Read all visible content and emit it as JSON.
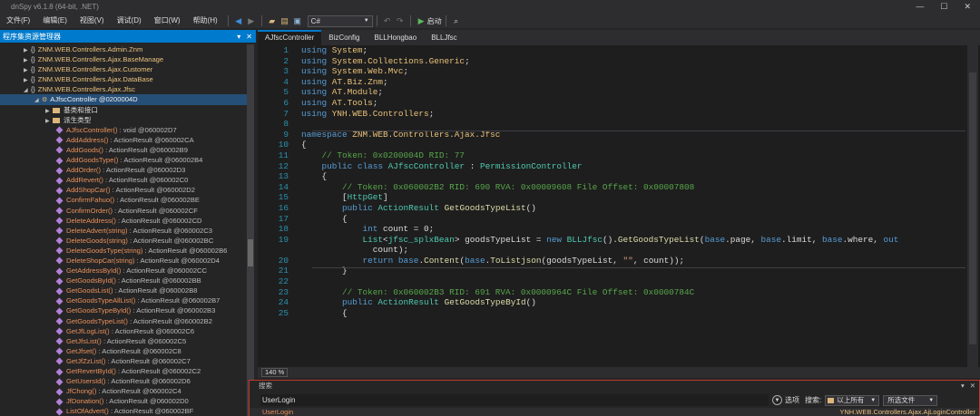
{
  "window": {
    "title": "dnSpy v6.1.8 (64-bit, .NET)",
    "minimize": "—",
    "restore": "☐",
    "close": "✕"
  },
  "menu": [
    {
      "label": "文件(F)"
    },
    {
      "label": "编辑(E)"
    },
    {
      "label": "视图(V)"
    },
    {
      "label": "调试(D)"
    },
    {
      "label": "窗口(W)"
    },
    {
      "label": "帮助(H)"
    }
  ],
  "toolbar": {
    "language": "C#",
    "run_label": "启动"
  },
  "explorer": {
    "title": "程序集资源管理器",
    "namespaces": [
      "ZNM.WEB.Controllers.Admin.Znm",
      "ZNM.WEB.Controllers.Ajax.BaseManage",
      "ZNM.WEB.Controllers.Ajax.Customer",
      "ZNM.WEB.Controllers.Ajax.DataBase",
      "ZNM.WEB.Controllers.Ajax.Jfsc"
    ],
    "selected_class": "AJfscController @0200004D",
    "folders": [
      "基类和接口",
      "派生类型"
    ],
    "methods": [
      {
        "name": "AJfscController()",
        "rest": " : void @060002D7"
      },
      {
        "name": "AddAddress()",
        "rest": " : ActionResult @060002CA"
      },
      {
        "name": "AddGoods()",
        "rest": " : ActionResult @060002B9"
      },
      {
        "name": "AddGoodsType()",
        "rest": " : ActionResult @060002B4"
      },
      {
        "name": "AddOrder()",
        "rest": " : ActionResult @060002D3"
      },
      {
        "name": "AddRevert()",
        "rest": " : ActionResult @060002C0"
      },
      {
        "name": "AddShopCar()",
        "rest": " : ActionResult @060002D2"
      },
      {
        "name": "ConfirmFahuo()",
        "rest": " : ActionResult @060002BE"
      },
      {
        "name": "ConfirmOrder()",
        "rest": " : ActionResult @060002CF"
      },
      {
        "name": "DeleteAddress()",
        "rest": " : ActionResult @060002CD"
      },
      {
        "name": "DeleteAdvert(string)",
        "rest": " : ActionResult @060002C3"
      },
      {
        "name": "DeleteGoods(string)",
        "rest": " : ActionResult @060002BC"
      },
      {
        "name": "DeleteGoodsType(string)",
        "rest": " : ActionResult @060002B6"
      },
      {
        "name": "DeleteShopCar(string)",
        "rest": " : ActionResult @060002D4"
      },
      {
        "name": "GetAddressById()",
        "rest": " : ActionResult @060002CC"
      },
      {
        "name": "GetGoodsById()",
        "rest": " : ActionResult @060002BB"
      },
      {
        "name": "GetGoodsList()",
        "rest": " : ActionResult @060002B8"
      },
      {
        "name": "GetGoodsTypeAllList()",
        "rest": " : ActionResult @060002B7"
      },
      {
        "name": "GetGoodsTypeById()",
        "rest": " : ActionResult @060002B3"
      },
      {
        "name": "GetGoodsTypeList()",
        "rest": " : ActionResult @060002B2"
      },
      {
        "name": "GetJfLogList()",
        "rest": " : ActionResult @060002C6"
      },
      {
        "name": "GetJfsList()",
        "rest": " : ActionResult @060002C5"
      },
      {
        "name": "GetJfset()",
        "rest": " : ActionResult @060002C8"
      },
      {
        "name": "GetJfZzList()",
        "rest": " : ActionResult @060002C7"
      },
      {
        "name": "GetRevertById()",
        "rest": " : ActionResult @060002C2"
      },
      {
        "name": "GetUsersId()",
        "rest": " : ActionResult @060002D6"
      },
      {
        "name": "JfChong()",
        "rest": " : ActionResult @060002C4"
      },
      {
        "name": "JfDonation()",
        "rest": " : ActionResult @060002D0"
      },
      {
        "name": "ListOfAdvert()",
        "rest": " : ActionResult @060002BF"
      }
    ]
  },
  "tabs": [
    {
      "label": "AJfscController"
    },
    {
      "label": "BizConfig"
    },
    {
      "label": "BLLHongbao"
    },
    {
      "label": "BLLJfsc"
    }
  ],
  "code": {
    "lines": [
      {
        "n": "1",
        "parts": [
          [
            "kw",
            "using"
          ],
          [
            "tx",
            " "
          ],
          [
            "ns",
            "System"
          ],
          [
            "tx",
            ";"
          ]
        ]
      },
      {
        "n": "2",
        "parts": [
          [
            "kw",
            "using"
          ],
          [
            "tx",
            " "
          ],
          [
            "ns",
            "System.Collections.Generic"
          ],
          [
            "tx",
            ";"
          ]
        ]
      },
      {
        "n": "3",
        "parts": [
          [
            "kw",
            "using"
          ],
          [
            "tx",
            " "
          ],
          [
            "ns",
            "System.Web.Mvc"
          ],
          [
            "tx",
            ";"
          ]
        ]
      },
      {
        "n": "4",
        "parts": [
          [
            "kw",
            "using"
          ],
          [
            "tx",
            " "
          ],
          [
            "ns",
            "AT.Biz.Znm"
          ],
          [
            "tx",
            ";"
          ]
        ]
      },
      {
        "n": "5",
        "parts": [
          [
            "kw",
            "using"
          ],
          [
            "tx",
            " "
          ],
          [
            "ns",
            "AT.Module"
          ],
          [
            "tx",
            ";"
          ]
        ]
      },
      {
        "n": "6",
        "parts": [
          [
            "kw",
            "using"
          ],
          [
            "tx",
            " "
          ],
          [
            "ns",
            "AT.Tools"
          ],
          [
            "tx",
            ";"
          ]
        ]
      },
      {
        "n": "7",
        "parts": [
          [
            "kw",
            "using"
          ],
          [
            "tx",
            " "
          ],
          [
            "ns",
            "YNH.WEB.Controllers"
          ],
          [
            "tx",
            ";"
          ]
        ]
      },
      {
        "n": "8",
        "parts": []
      },
      {
        "n": "9",
        "parts": [
          [
            "kw",
            "namespace"
          ],
          [
            "tx",
            " "
          ],
          [
            "ns",
            "ZNM.WEB.Controllers.Ajax.Jfsc"
          ]
        ]
      },
      {
        "n": "10",
        "parts": [
          [
            "tx",
            "{"
          ]
        ]
      },
      {
        "n": "11",
        "parts": [
          [
            "tx",
            "    "
          ],
          [
            "cm",
            "// Token: 0x0200004D RID: 77"
          ]
        ]
      },
      {
        "n": "12",
        "parts": [
          [
            "tx",
            "    "
          ],
          [
            "kw",
            "public class"
          ],
          [
            "tx",
            " "
          ],
          [
            "ty",
            "AJfscController"
          ],
          [
            "tx",
            " : "
          ],
          [
            "ty",
            "PermissionController"
          ]
        ]
      },
      {
        "n": "13",
        "parts": [
          [
            "tx",
            "    {"
          ]
        ]
      },
      {
        "n": "14",
        "parts": [
          [
            "tx",
            "        "
          ],
          [
            "cm",
            "// Token: 0x060002B2 RID: 690 RVA: 0x00009608 File Offset: 0x00007808"
          ]
        ]
      },
      {
        "n": "15",
        "parts": [
          [
            "tx",
            "        ["
          ],
          [
            "ty",
            "HttpGet"
          ],
          [
            "tx",
            "]"
          ]
        ]
      },
      {
        "n": "16",
        "parts": [
          [
            "tx",
            "        "
          ],
          [
            "kw",
            "public"
          ],
          [
            "tx",
            " "
          ],
          [
            "ty",
            "ActionResult"
          ],
          [
            "tx",
            " "
          ],
          [
            "fn",
            "GetGoodsTypeList"
          ],
          [
            "tx",
            "()"
          ]
        ]
      },
      {
        "n": "17",
        "parts": [
          [
            "tx",
            "        {"
          ]
        ]
      },
      {
        "n": "18",
        "parts": [
          [
            "tx",
            "            "
          ],
          [
            "kw",
            "int"
          ],
          [
            "tx",
            " count = 0;"
          ]
        ]
      },
      {
        "n": "19",
        "parts": [
          [
            "tx",
            "            "
          ],
          [
            "ty",
            "List"
          ],
          [
            "tx",
            "<"
          ],
          [
            "ty",
            "jfsc_splxBean"
          ],
          [
            "tx",
            "> goodsTypeList = "
          ],
          [
            "kw",
            "new"
          ],
          [
            "tx",
            " "
          ],
          [
            "ty",
            "BLLJfsc"
          ],
          [
            "tx",
            "()."
          ],
          [
            "fn",
            "GetGoodsTypeList"
          ],
          [
            "tx",
            "("
          ],
          [
            "kw",
            "base"
          ],
          [
            "tx",
            ".page, "
          ],
          [
            "kw",
            "base"
          ],
          [
            "tx",
            ".limit, "
          ],
          [
            "kw",
            "base"
          ],
          [
            "tx",
            ".where, "
          ],
          [
            "kw",
            "out"
          ]
        ]
      },
      {
        "n": "",
        "parts": [
          [
            "tx",
            "              count);"
          ]
        ]
      },
      {
        "n": "20",
        "parts": [
          [
            "tx",
            "            "
          ],
          [
            "kw",
            "return"
          ],
          [
            "tx",
            " "
          ],
          [
            "kw",
            "base"
          ],
          [
            "tx",
            "."
          ],
          [
            "fn",
            "Content"
          ],
          [
            "tx",
            "("
          ],
          [
            "kw",
            "base"
          ],
          [
            "tx",
            "."
          ],
          [
            "fn",
            "ToListjson"
          ],
          [
            "tx",
            "(goodsTypeList, "
          ],
          [
            "st",
            "\"\""
          ],
          [
            "tx",
            ", count));"
          ]
        ]
      },
      {
        "n": "21",
        "parts": [
          [
            "tx",
            "        }"
          ]
        ]
      },
      {
        "n": "22",
        "parts": []
      },
      {
        "n": "23",
        "parts": [
          [
            "tx",
            "        "
          ],
          [
            "cm",
            "// Token: 0x060002B3 RID: 691 RVA: 0x0000964C File Offset: 0x0000784C"
          ]
        ]
      },
      {
        "n": "24",
        "parts": [
          [
            "tx",
            "        "
          ],
          [
            "kw",
            "public"
          ],
          [
            "tx",
            " "
          ],
          [
            "ty",
            "ActionResult"
          ],
          [
            "tx",
            " "
          ],
          [
            "fn",
            "GetGoodsTypeById"
          ],
          [
            "tx",
            "()"
          ]
        ]
      },
      {
        "n": "25",
        "parts": [
          [
            "tx",
            "        {"
          ]
        ]
      }
    ]
  },
  "zoom": "140 %",
  "search": {
    "title": "搜索",
    "value": "UserLogin",
    "options_label": "选项",
    "search_label": "搜索:",
    "scope": "以上所有",
    "target": "所选文件",
    "result_name": "UserLogin",
    "result_location": "YNH.WEB.Controllers.Ajax.AjLoginController"
  },
  "colors": {
    "accent": "#007acc",
    "search_border": "#c0392b"
  }
}
